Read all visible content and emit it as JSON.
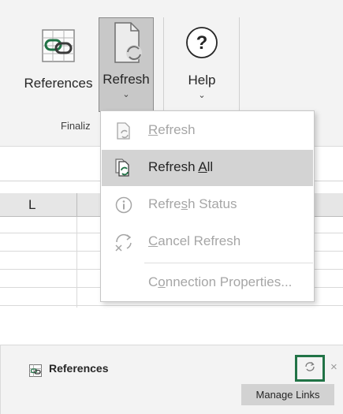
{
  "ribbon": {
    "references_label": "References",
    "refresh_label": "Refresh",
    "help_label": "Help",
    "chevron": "⌄",
    "help_glyph": "?",
    "group_label": "Finaliz",
    "icons": {
      "references": "chain-link-icon",
      "refresh": "document-refresh-icon",
      "help": "help-circle-icon"
    }
  },
  "sheet": {
    "column_label": "L"
  },
  "menu": {
    "items": [
      {
        "pre": "",
        "key": "R",
        "post": "efresh",
        "enabled": false,
        "icon": "refresh-document-icon"
      },
      {
        "pre": "Refresh ",
        "key": "A",
        "post": "ll",
        "enabled": true,
        "highlighted": true,
        "icon": "refresh-all-icon"
      },
      {
        "pre": "Refre",
        "key": "s",
        "post": "h Status",
        "enabled": false,
        "icon": "info-icon"
      },
      {
        "pre": "",
        "key": "C",
        "post": "ancel Refresh",
        "enabled": false,
        "icon": "cancel-refresh-icon"
      },
      {
        "pre": "C",
        "key": "o",
        "post": "nnection Properties...",
        "enabled": false
      }
    ]
  },
  "pane": {
    "title": "References",
    "close_glyph": "×",
    "manage_links_label": "Manage Links",
    "highlight_color": "#217346",
    "icons": {
      "title": "references-pane-icon",
      "refresh": "refresh-icon",
      "close": "close-icon"
    }
  }
}
